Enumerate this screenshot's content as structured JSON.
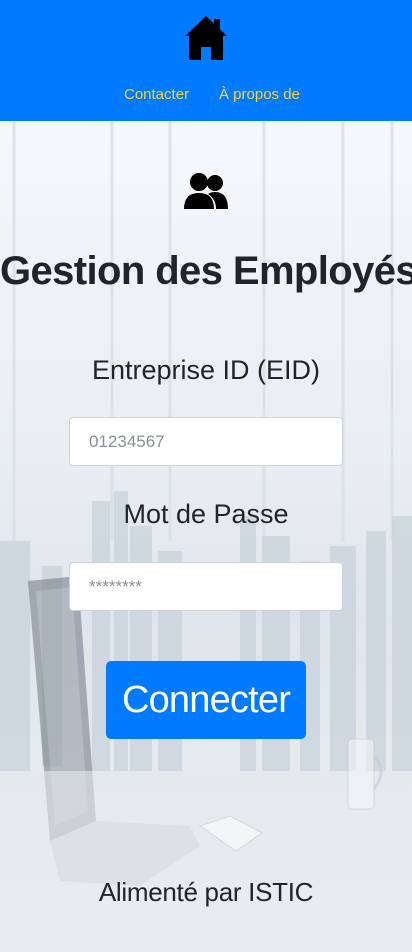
{
  "header": {
    "home_icon": "home-icon",
    "nav": [
      {
        "label": "Contacter"
      },
      {
        "label": "À propos de"
      }
    ],
    "background_color": "#007bff",
    "link_color": "#ffd23c"
  },
  "main": {
    "users_icon": "users-icon",
    "title": "Gestion des Employés",
    "eid_label": "Entreprise ID (EID)",
    "eid_placeholder": "01234567",
    "password_label": "Mot de Passe",
    "password_placeholder": "********",
    "submit_label": "Connecter"
  },
  "footer": {
    "text": "Alimenté par ISTIC"
  }
}
